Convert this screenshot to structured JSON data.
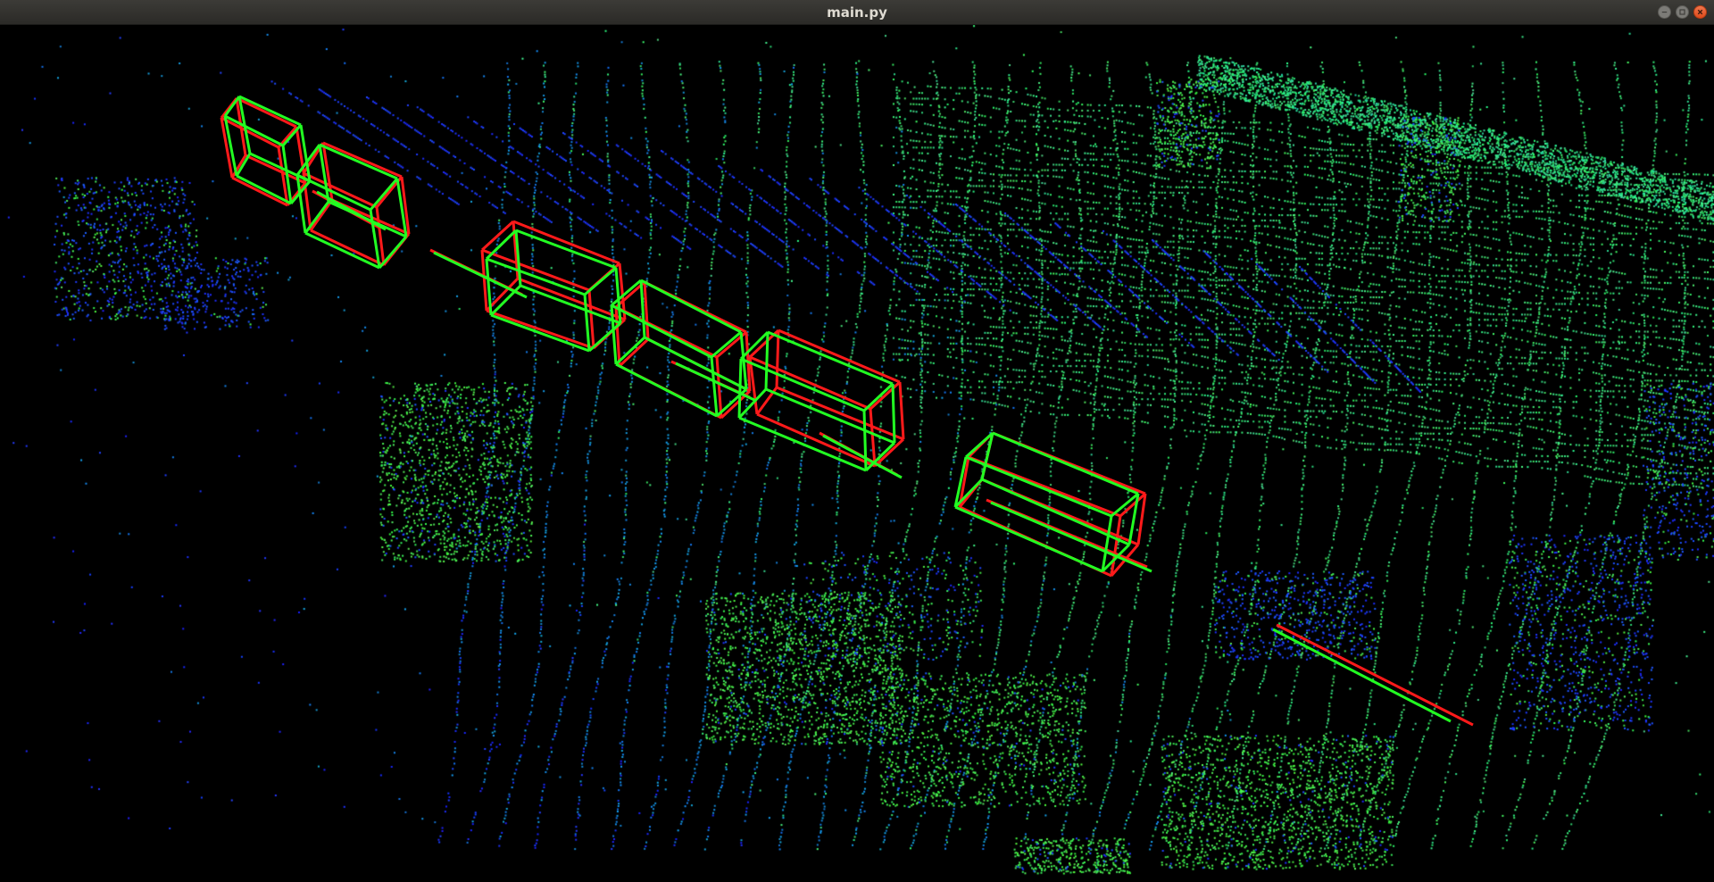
{
  "window": {
    "title": "main.py"
  },
  "window_controls": {
    "minimize_icon": "minimize-icon",
    "maximize_icon": "maximize-icon",
    "close_icon": "close-icon"
  },
  "scene": {
    "background": "#000000",
    "point_colors": [
      "#1a1aff",
      "#2244ff",
      "#1fb0c0",
      "#33e07a",
      "#44ff44"
    ],
    "ground_truth_color": "#ff1a1a",
    "prediction_color": "#22ff22",
    "box_count": 7
  }
}
